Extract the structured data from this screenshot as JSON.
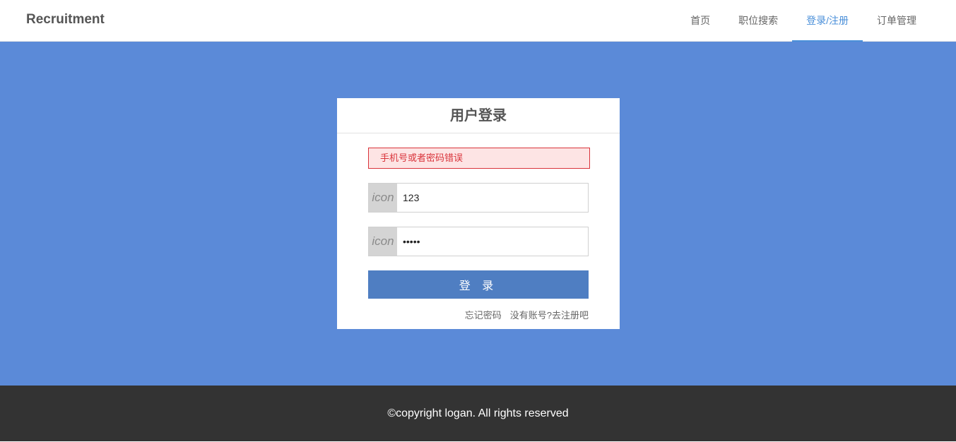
{
  "navbar": {
    "brand": "Recruitment",
    "items": [
      {
        "label": "首页",
        "active": false
      },
      {
        "label": "职位搜索",
        "active": false
      },
      {
        "label": "登录/注册",
        "active": true
      },
      {
        "label": "订单管理",
        "active": false
      }
    ]
  },
  "login": {
    "title": "用户登录",
    "error": "手机号或者密码错误",
    "username": {
      "icon_label": "icon",
      "value": "123"
    },
    "password": {
      "icon_label": "icon",
      "value": "12345"
    },
    "submit_label": "登 录",
    "forgot_link": "忘记密码",
    "register_link": "没有账号?去注册吧"
  },
  "footer": {
    "text": "©copyright logan. All rights reserved"
  },
  "colors": {
    "accent": "#4a8fd9",
    "background": "#5b8ad8",
    "button": "#4f7ec2",
    "error": "#d9333a",
    "footer": "#333333"
  }
}
